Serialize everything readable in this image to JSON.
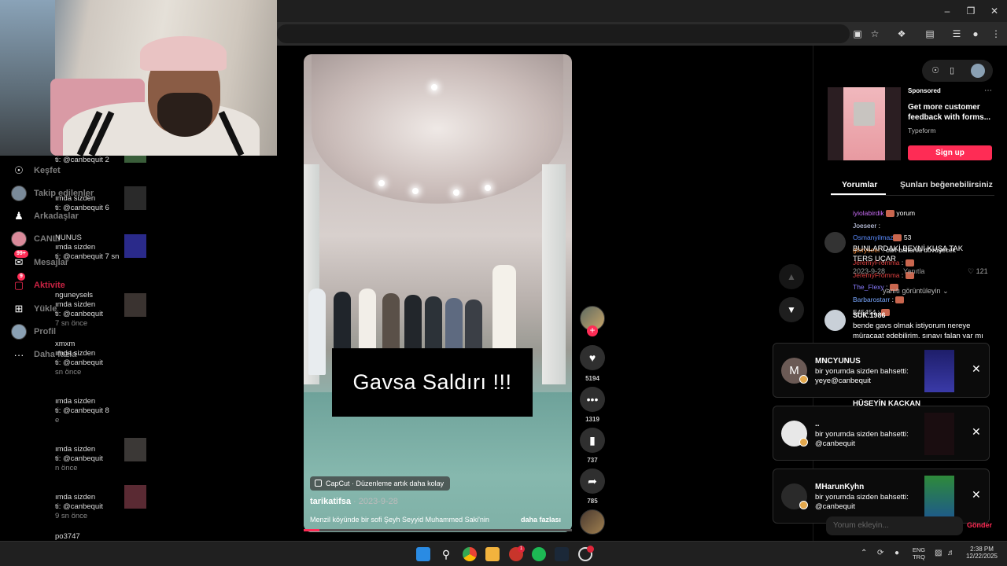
{
  "sidebar": {
    "items": [
      {
        "label": "Keşfet",
        "icon": "compass-icon"
      },
      {
        "label": "Takip edilenler",
        "icon": "avatar"
      },
      {
        "label": "Arkadaşlar",
        "icon": "friends-icon"
      },
      {
        "label": "CANLI",
        "icon": "live-avatar"
      },
      {
        "label": "Mesajlar",
        "icon": "messages-icon",
        "badge": "99+"
      },
      {
        "label": "Aktivite",
        "icon": "activity-icon",
        "badge": "9"
      },
      {
        "label": "Yükle",
        "icon": "upload-icon"
      },
      {
        "label": "Profil",
        "icon": "profile-avatar"
      },
      {
        "label": "Daha fazla",
        "icon": "more-icon"
      }
    ],
    "notifications": [
      {
        "lines": [
          "ti: @canbequit 2"
        ]
      },
      {
        "lines": [
          "ımda sizden",
          "ti: @canbequit 6"
        ]
      },
      {
        "lines": [
          "NUNUS",
          "ımda sizden",
          "ti: @canbequit 7 sn"
        ]
      },
      {
        "lines": [
          "nguneysels",
          "ımda sizden",
          "ti: @canbequit",
          "7 sn önce"
        ]
      },
      {
        "lines": [
          "xmxm",
          "ımda sizden",
          "ti: @canbequit",
          "sn önce"
        ]
      },
      {
        "lines": [
          "ımda sizden",
          "ti: @canbequit 8",
          "e"
        ]
      },
      {
        "lines": [
          "ımda sizden",
          "ti: @canbequit",
          "n önce"
        ]
      },
      {
        "lines": [
          "ımda sizden",
          "ti: @canbequit",
          "9 sn önce"
        ]
      },
      {
        "lines": [
          "po3747"
        ]
      }
    ]
  },
  "video": {
    "caption": "Gavsa Saldırı !!!",
    "capcut_label": "CapCut · Düzenleme artık daha kolay",
    "author": "tarikatifsa",
    "date": " · 2023-9-28",
    "description": "Menzil köyünde bir sofi Şeyh Seyyid Muhammed Saki'nin",
    "more_label": "daha fazlası",
    "progress_fraction": 0.06
  },
  "actions": {
    "likes": "5194",
    "comments": "1319",
    "saves": "737",
    "shares": "785"
  },
  "ad": {
    "sponsored": "Sponsored",
    "headline": "Get more customer feedback with forms...",
    "brand": "Typeform",
    "cta": "Sign up"
  },
  "tabs": {
    "comments": "Yorumlar",
    "you_may_like": "Şunları beğenebilirsiniz"
  },
  "live_chat": [
    {
      "user": "iyiolabirdik",
      "text": " yorum",
      "color": "#c86cf5"
    },
    {
      "user": "Joeseer",
      "text": " :",
      "color": "#d9e0ff"
    },
    {
      "user": "Osmanyilmaz",
      "text": " 53",
      "color": "#5b8cff"
    },
    {
      "user": "gloryseer",
      "text": " : can baltonla dövüşecek",
      "color": "#f08a3c"
    },
    {
      "user": "JeremyFromma",
      "text": " :",
      "color": "#e04040"
    },
    {
      "user": "JeremyFromma",
      "text": " :",
      "color": "#e04040"
    },
    {
      "user": "The_Flexy",
      "text": " :",
      "color": "#8a7cff"
    },
    {
      "user": "Barbarostarr",
      "text": " :",
      "color": "#7aa8ff"
    },
    {
      "user": "E45454",
      "text": " :",
      "color": "#ddd"
    }
  ],
  "comments": [
    {
      "text": "BUNLARDAKİ BEYNİ KUŞA TAK TERS UÇAR",
      "date": "2023-9-28",
      "reply": "Yanıtla",
      "likes": "121",
      "view_replies": "yanıtı görüntüleyin"
    },
    {
      "user": "SUK.1986",
      "text": "bende gavs olmak istiyorum nereye müracaat edebilirim. sınavı falan var mı"
    },
    {
      "user": "HÜSEYİN KACKAN"
    }
  ],
  "toasts": [
    {
      "name": "MNCYUNUS",
      "text": "bir yorumda sizden bahsetti: yeye@canbequit",
      "avatar_letter": "M"
    },
    {
      "name": "..",
      "text": "bir yorumda sizden bahsetti: @canbequit",
      "avatar_letter": ""
    },
    {
      "name": "MHarunKyhn",
      "text": "bir yorumda sizden bahsetti: @canbequit",
      "avatar_letter": ""
    }
  ],
  "comment_input": {
    "placeholder": "Yorum ekleyin...",
    "post": "Gönder"
  },
  "taskbar": {
    "lang_top": "ENG",
    "lang_bottom": "TRQ",
    "time": "2:38 PM",
    "date": "12/22/2025"
  }
}
